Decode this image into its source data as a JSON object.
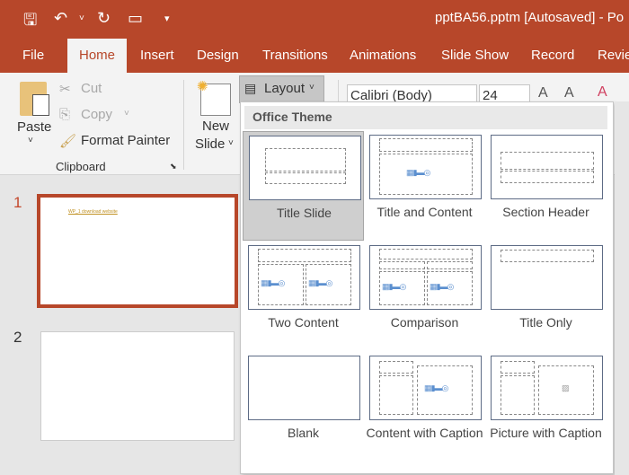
{
  "title": "pptBA56.pptm [Autosaved]  -  Po",
  "quick_access": {
    "save": "save-icon",
    "undo": "undo-icon",
    "redo": "repeat-icon",
    "present": "present-icon",
    "customize": "▾"
  },
  "tabs": [
    "File",
    "Home",
    "Insert",
    "Design",
    "Transitions",
    "Animations",
    "Slide Show",
    "Record",
    "Revie"
  ],
  "active_tab": "Home",
  "ribbon": {
    "paste": "Paste",
    "cut": "Cut",
    "copy": "Copy",
    "format_painter": "Format Painter",
    "clipboard_group": "Clipboard",
    "new_slide_1": "New",
    "new_slide_2": "Slide",
    "layout": "Layout",
    "font": "Calibri (Body)",
    "size": "24"
  },
  "slides": [
    {
      "number": "1",
      "text": "WP_1 download website",
      "selected": true
    },
    {
      "number": "2",
      "text": ""
    }
  ],
  "gallery": {
    "header": "Office Theme",
    "layouts": [
      {
        "label": "Title Slide",
        "selected": true
      },
      {
        "label": "Title and Content"
      },
      {
        "label": "Section Header"
      },
      {
        "label": "Two Content"
      },
      {
        "label": "Comparison"
      },
      {
        "label": "Title Only"
      },
      {
        "label": "Blank"
      },
      {
        "label": "Content with Caption"
      },
      {
        "label": "Picture with Caption"
      }
    ]
  },
  "colors": {
    "accent": "#b7472a",
    "ribbon": "#f3f3f3"
  }
}
